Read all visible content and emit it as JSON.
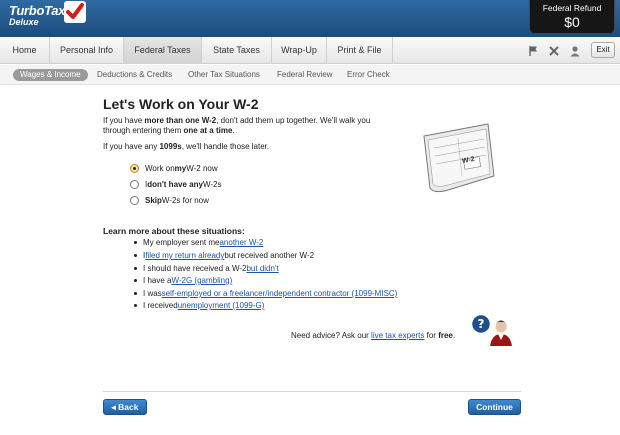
{
  "app": {
    "brand": "TurboTax",
    "edition": "Deluxe"
  },
  "refund": {
    "label": "Federal Refund",
    "amount": "$0"
  },
  "main_nav": {
    "tabs": [
      {
        "label": "Home"
      },
      {
        "label": "Personal Info"
      },
      {
        "label": "Federal Taxes"
      },
      {
        "label": "State Taxes"
      },
      {
        "label": "Wrap-Up"
      },
      {
        "label": "Print & File"
      }
    ],
    "active": "Federal Taxes",
    "exit_label": "Exit",
    "icons": [
      "flag-icon",
      "tools-icon",
      "person-icon"
    ]
  },
  "sub_nav": {
    "items": [
      {
        "label": "Wages & Income"
      },
      {
        "label": "Deductions & Credits"
      },
      {
        "label": "Other Tax Situations"
      },
      {
        "label": "Federal Review"
      },
      {
        "label": "Error Check"
      }
    ],
    "active": "Wages & Income"
  },
  "content": {
    "title": "Let's Work on Your W-2",
    "intro": {
      "p1_a": "If you have ",
      "p1_b": "more than one W-2",
      "p1_c": ", don't add them up together. We'll walk you",
      "p1_d": "through entering them ",
      "p1_e": "one at a time",
      "p1_f": ".",
      "p2_a": "If you have any ",
      "p2_b": "1099s",
      "p2_c": ", we'll handle those later."
    },
    "options": [
      {
        "pre": "Work on ",
        "bold": "my",
        "post": " W-2 now",
        "selected": true
      },
      {
        "pre": "I ",
        "bold": "don't have any",
        "post": " W-2s",
        "selected": false
      },
      {
        "pre": "",
        "bold": "Skip",
        "post": " W-2s for now",
        "selected": false
      }
    ],
    "learn_title": "Learn more about these situations:",
    "learn_items": [
      {
        "pre": "My employer sent me ",
        "link": "another W-2",
        "post": ""
      },
      {
        "pre": "I ",
        "link": "filed my return already",
        "post": " but received another W-2"
      },
      {
        "pre": "I should have received a W-2 ",
        "link": "but didn't",
        "post": ""
      },
      {
        "pre": "I have a ",
        "link": "W-2G (gambling)",
        "post": ""
      },
      {
        "pre": "I was ",
        "link": "self-employed or a freelancer/independent contractor (1099-MISC)",
        "post": ""
      },
      {
        "pre": "I received ",
        "link": "unemployment (1099-G)",
        "post": ""
      }
    ],
    "advice": {
      "pre": "Need advice? Ask our ",
      "link": "live tax experts",
      "mid": " for ",
      "bold": "free",
      "post": "."
    },
    "form_label": "W-2"
  },
  "buttons": {
    "back": "◂ Back",
    "continue": "Continue"
  },
  "colors": {
    "header": "#1c4c7d",
    "link": "#1a55a8",
    "button": "#2a6db5"
  }
}
